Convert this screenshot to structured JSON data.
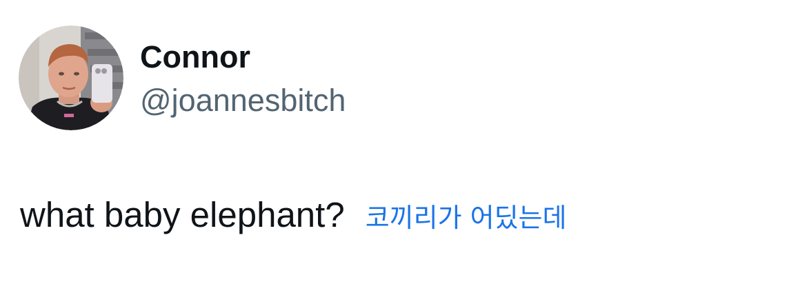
{
  "tweet": {
    "author": {
      "display_name": "Connor",
      "handle": "@joannesbitch",
      "avatar_icon": "profile-photo-avatar"
    },
    "text": "what baby elephant?",
    "translation": "코끼리가 어딨는데"
  },
  "colors": {
    "name": "#0f1419",
    "handle": "#536471",
    "text": "#0f1419",
    "translation": "#1a73e8",
    "background": "#ffffff"
  }
}
